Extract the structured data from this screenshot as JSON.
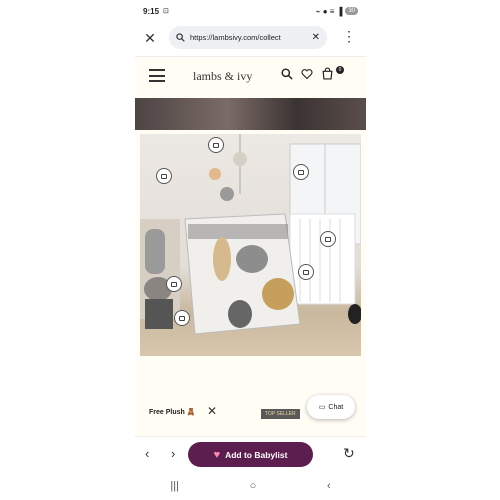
{
  "status_bar": {
    "time": "9:15",
    "signal": "⌁ ● ≡ ▐",
    "battery": "30"
  },
  "browser": {
    "url": "https://lambsivy.com/collect",
    "close_icon": "close-icon",
    "menu_icon": "more-vert-icon"
  },
  "site": {
    "brand": "lambs & ivy",
    "cart_count": "0"
  },
  "chips": {
    "free_plush": "Free Plush 🧸",
    "top_seller": "TOP SELLER"
  },
  "chat": {
    "label": "Chat"
  },
  "bottom_bar": {
    "babylist_label": "Add to Babylist",
    "back": "‹",
    "forward": "›",
    "reload": "↻"
  },
  "system_nav": {
    "recents": "|||",
    "home": "○",
    "back": "‹"
  },
  "colors": {
    "babylist": "#5c1e4f",
    "site_bg": "#fffdf4"
  }
}
